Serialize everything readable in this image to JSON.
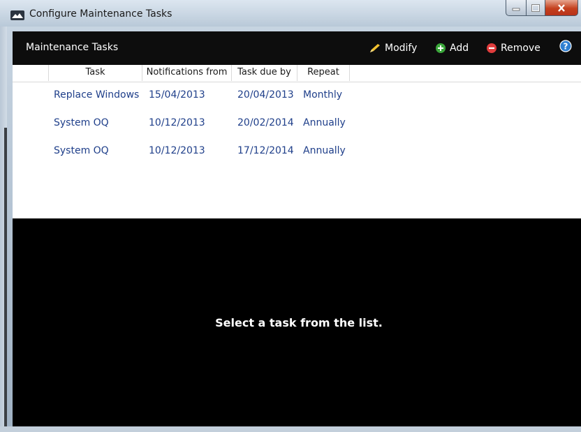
{
  "window": {
    "title": "Configure Maintenance Tasks",
    "controls": {
      "minimize": "minimize",
      "maximize": "maximize",
      "close": "close"
    }
  },
  "header": {
    "title": "Maintenance Tasks",
    "actions": {
      "modify": "Modify",
      "add": "Add",
      "remove": "Remove"
    },
    "icons": {
      "modify": "pencil-icon",
      "add": "add-circle-icon",
      "remove": "remove-circle-icon",
      "help": "help-icon"
    }
  },
  "table": {
    "columns": [
      "Task",
      "Notifications from",
      "Task due by",
      "Repeat"
    ],
    "rows": [
      {
        "task": "Replace Windows",
        "notify": "15/04/2013",
        "due": "20/04/2013",
        "repeat": "Monthly"
      },
      {
        "task": "System OQ",
        "notify": "10/12/2013",
        "due": "20/02/2014",
        "repeat": "Annually"
      },
      {
        "task": "System OQ",
        "notify": "10/12/2013",
        "due": "17/12/2014",
        "repeat": "Annually"
      }
    ]
  },
  "details": {
    "message": "Select a task from the list."
  },
  "colors": {
    "header_bg": "#0d0d0d",
    "link_text": "#1f3f8a",
    "add_green": "#3aa63a",
    "remove_red": "#e03c3c",
    "help_blue": "#2f7fd1"
  }
}
